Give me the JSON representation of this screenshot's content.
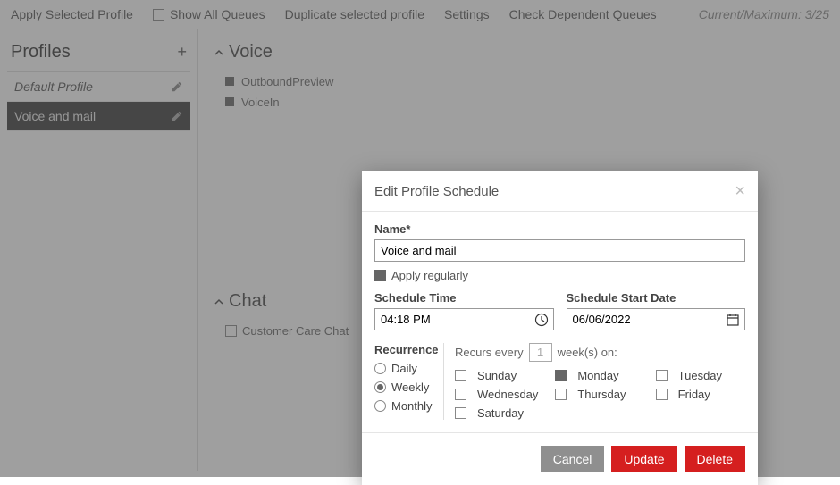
{
  "toolbar": {
    "apply": "Apply Selected Profile",
    "show_all": "Show All Queues",
    "duplicate": "Duplicate selected profile",
    "settings": "Settings",
    "check": "Check Dependent Queues",
    "status": "Current/Maximum: 3/25"
  },
  "sidebar": {
    "title": "Profiles",
    "items": [
      {
        "label": "Default Profile",
        "active": false
      },
      {
        "label": "Voice and mail",
        "active": true
      }
    ]
  },
  "sections": {
    "voice": {
      "title": "Voice",
      "items": [
        "OutboundPreview",
        "VoiceIn"
      ]
    },
    "chat": {
      "title": "Chat",
      "items": [
        "Customer Care Chat"
      ]
    }
  },
  "modal": {
    "title": "Edit Profile Schedule",
    "name_label": "Name*",
    "name_value": "Voice and mail",
    "apply_label": "Apply regularly",
    "time_label": "Schedule Time",
    "time_value": "04:18 PM",
    "date_label": "Schedule Start Date",
    "date_value": "06/06/2022",
    "recurrence_label": "Recurrence",
    "recurs_prefix": "Recurs every",
    "recurs_value": "1",
    "recurs_suffix": "week(s) on:",
    "freq": {
      "daily": "Daily",
      "weekly": "Weekly",
      "monthly": "Monthly"
    },
    "days": {
      "sun": "Sunday",
      "mon": "Monday",
      "tue": "Tuesday",
      "wed": "Wednesday",
      "thu": "Thursday",
      "fri": "Friday",
      "sat": "Saturday"
    },
    "buttons": {
      "cancel": "Cancel",
      "update": "Update",
      "delete": "Delete"
    }
  }
}
